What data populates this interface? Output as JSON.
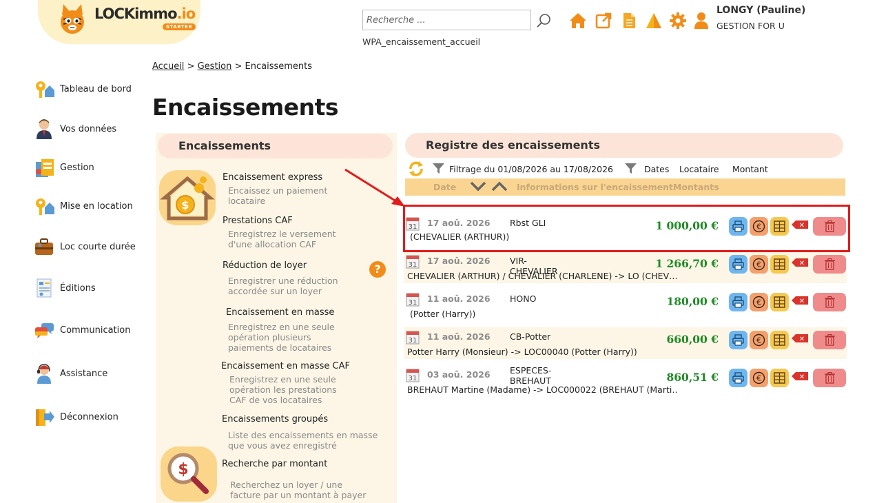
{
  "app": {
    "logo_main": "LOCKimmo",
    "logo_suffix": ".io",
    "logo_badge": "STARTER"
  },
  "header": {
    "search_placeholder": "Recherche ...",
    "page_code": "WPA_encaissement_accueil",
    "icons": [
      "home-icon",
      "external-link-icon",
      "document-icon",
      "warning-icon",
      "gear-icon",
      "user-icon"
    ],
    "user_name": "LONGY (Pauline)",
    "user_company": "GESTION FOR U",
    "accent_color": "#f28c18"
  },
  "sidebar": {
    "items": [
      {
        "label": "Tableau de bord",
        "icon": "dashboard-keys-icon"
      },
      {
        "label": "Vos données",
        "icon": "person-icon"
      },
      {
        "label": "Gestion",
        "icon": "management-icon"
      },
      {
        "label": "Mise en location",
        "icon": "rental-keys-icon"
      },
      {
        "label": "Loc courte durée",
        "icon": "suitcase-icon"
      },
      {
        "label": "Éditions",
        "icon": "report-icon"
      },
      {
        "label": "Communication",
        "icon": "chat-icon"
      },
      {
        "label": "Assistance",
        "icon": "support-agent-icon"
      },
      {
        "label": "Déconnexion",
        "icon": "logout-icon"
      }
    ]
  },
  "breadcrumb": {
    "home": "Accueil",
    "sep1": ">",
    "section": "Gestion",
    "sep2": ">",
    "current": "Encaissements"
  },
  "page_title": "Encaissements",
  "left_panel": {
    "title": "Encaissements",
    "help": "?",
    "menu": [
      {
        "title": "Encaissement express",
        "desc": [
          "Encaissez un paiement",
          "locataire"
        ]
      },
      {
        "title": "Prestations CAF",
        "desc": [
          "Enregistrez le versement",
          "d'une allocation CAF"
        ]
      },
      {
        "title": "Réduction de loyer",
        "desc": [
          "Enregistrer une réduction",
          "accordée sur un loyer"
        ]
      },
      {
        "title": "Encaissement en masse",
        "desc": [
          "Enregistrez en une seule",
          "opération plusieurs",
          "paiements de locataires"
        ]
      },
      {
        "title": "Encaissement en masse CAF",
        "desc": [
          "Enregistrez en une seule",
          "opération les prestations",
          "CAF de vos locataires"
        ]
      },
      {
        "title": "Encaissements groupés",
        "desc": [
          "Liste des encaissements en masse",
          "que vous avez enregistré"
        ]
      },
      {
        "title": "Recherche par montant",
        "desc": [
          "Recherchez un loyer / une",
          "facture par un montant à payer"
        ]
      }
    ]
  },
  "register": {
    "title": "Registre des encaissements",
    "filter_text": "Filtrage du 01/08/2026 au 17/08/2026",
    "filter_dates": "Dates",
    "filter_tenant": "Locataire",
    "filter_amount": "Montant",
    "col_date": "Date",
    "col_info": "Informations sur l'encaissement",
    "col_amounts": "Montants",
    "calendar_day": "31",
    "delete_badge": "✕",
    "rows": [
      {
        "date": "17 aoû. 2026",
        "label": "Rbst GLI",
        "amount": "1 000,00 €",
        "sub": "(CHEVALIER (ARTHUR))"
      },
      {
        "date": "17 aoû. 2026",
        "label": "VIR-CHEVALIER",
        "amount": "1 266,70 €",
        "sub": "CHEVALIER (ARTHUR) / CHEVALIER (CHARLENE) -> LO (CHEV…"
      },
      {
        "date": "11 aoû. 2026",
        "label": "HONO",
        "amount": "180,00 €",
        "sub": "(Potter (Harry))"
      },
      {
        "date": "11 aoû. 2026",
        "label": "CB-Potter",
        "amount": "660,00 €",
        "sub": "Potter Harry (Monsieur) -> LOC00040 (Potter (Harry))"
      },
      {
        "date": "03 aoû. 2026",
        "label": "ESPECES-BREHAUT",
        "amount": "860,51 €",
        "sub": "BREHAUT Martine (Madame) -> LOC000022 (BREHAUT (Marti…"
      }
    ]
  }
}
